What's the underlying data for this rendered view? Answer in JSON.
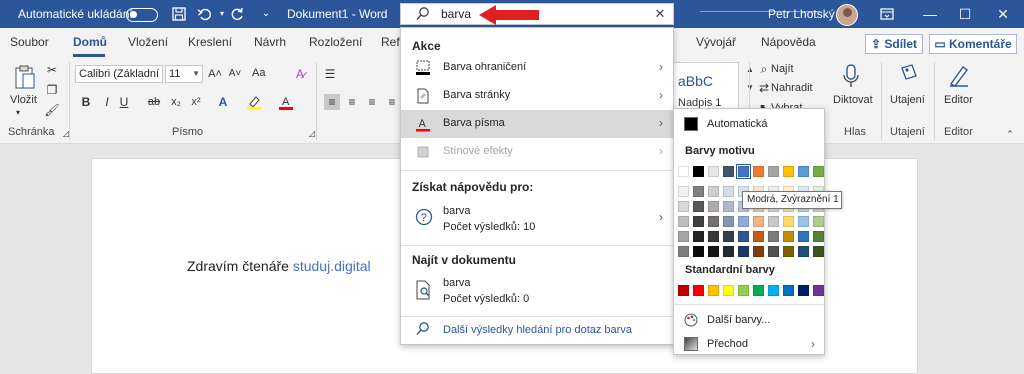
{
  "titlebar": {
    "autosave_label": "Automatické ukládání",
    "doc_title": "Dokument1 - Word",
    "user_name": "Petr Lhotský",
    "min": "—",
    "max": "☐",
    "close": "✕"
  },
  "search": {
    "value": "barva",
    "clear": "✕"
  },
  "menu": {
    "items": [
      "Soubor",
      "Domů",
      "Vložení",
      "Kreslení",
      "Návrh",
      "Rozložení",
      "Ref",
      "Vývojář",
      "Nápověda"
    ],
    "share": "Sdílet",
    "comments": "Komentáře"
  },
  "ribbon": {
    "paste": "Vložit",
    "font_name": "Calibri (Základní",
    "font_size": "11",
    "aa_label": "Aa",
    "groups": [
      "Schránka",
      "Písmo",
      "Hlas",
      "Utajení",
      "Editor"
    ],
    "styles_preview": "aBbC",
    "styles_name": "Nadpis 1",
    "find": "Najít",
    "replace": "Nahradit",
    "select": "Vybrat",
    "dictate": "Diktovat",
    "sensitivity": "Utajení",
    "editor": "Editor",
    "bold": "B",
    "italic": "I",
    "underline": "U",
    "strike": "ab",
    "sub": "x₂",
    "sup": "x²"
  },
  "results": {
    "actions_header": "Akce",
    "actions": [
      {
        "label": "Barva ohraničení"
      },
      {
        "label": "Barva stránky"
      },
      {
        "label": "Barva písma"
      },
      {
        "label": "Stínové efekty"
      }
    ],
    "help_header": "Získat nápovědu pro:",
    "help_item": {
      "title": "barva",
      "subtitle": "Počet výsledků: 10"
    },
    "find_header": "Najít v dokumentu",
    "find_item": {
      "title": "barva",
      "subtitle": "Počet výsledků: 0"
    },
    "more": "Další výsledky hledání pro dotaz barva"
  },
  "colors": {
    "automatic": "Automatická",
    "theme_header": "Barvy motivu",
    "standard_header": "Standardní barvy",
    "more_colors": "Další barvy...",
    "gradient": "Přechod",
    "tooltip": "Modrá, Zvýraznění 1",
    "theme_top": [
      "#ffffff",
      "#000000",
      "#e7e6e6",
      "#44546a",
      "#4472c4",
      "#ed7d31",
      "#a5a5a5",
      "#ffc000",
      "#5b9bd5",
      "#70ad47"
    ],
    "theme_shades": [
      [
        "#f2f2f2",
        "#7f7f7f",
        "#d0cece",
        "#d6dce4",
        "#d9e2f3",
        "#fbe5d5",
        "#ededed",
        "#fff2cc",
        "#deebf6",
        "#e2efd9"
      ],
      [
        "#d8d8d8",
        "#595959",
        "#aeabab",
        "#adb9ca",
        "#b4c6e7",
        "#f7cbac",
        "#dbdbdb",
        "#fee599",
        "#bdd7ee",
        "#c5e0b3"
      ],
      [
        "#bfbfbf",
        "#3f3f3f",
        "#757070",
        "#8496b0",
        "#8eaadb",
        "#f4b183",
        "#c9c9c9",
        "#ffd965",
        "#9cc3e5",
        "#a8d08d"
      ],
      [
        "#a5a5a5",
        "#262626",
        "#3a3838",
        "#323f4f",
        "#2f5496",
        "#c55a11",
        "#7b7b7b",
        "#bf8f00",
        "#2e75b5",
        "#538135"
      ],
      [
        "#7f7f7f",
        "#0c0c0c",
        "#171616",
        "#222a35",
        "#1f3864",
        "#833c0b",
        "#525252",
        "#7f6000",
        "#1e4e79",
        "#375623"
      ]
    ],
    "standard": [
      "#c00000",
      "#ff0000",
      "#ffc000",
      "#ffff00",
      "#92d050",
      "#00b050",
      "#00b0f0",
      "#0070c0",
      "#002060",
      "#7030a0"
    ]
  },
  "document": {
    "text_before": "Zdravím čtenáře ",
    "link": "studuj.digital"
  },
  "accent": "#2b579a",
  "arrow_color": "#e02020"
}
